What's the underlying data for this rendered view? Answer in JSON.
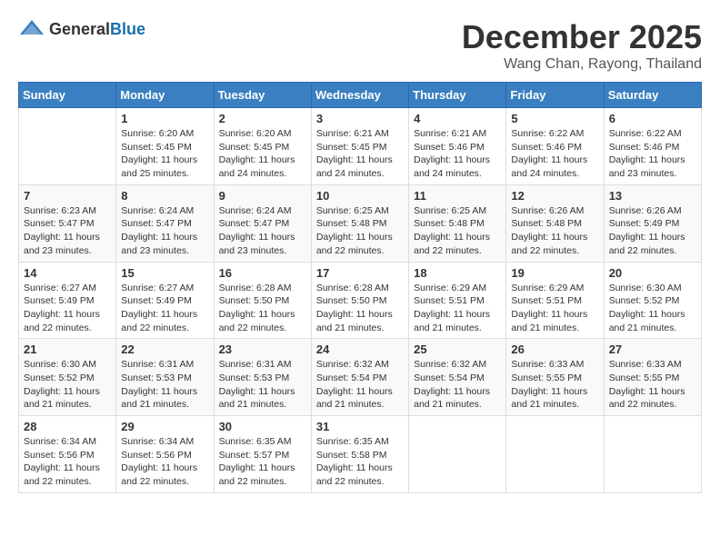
{
  "header": {
    "logo_general": "General",
    "logo_blue": "Blue",
    "month_title": "December 2025",
    "location": "Wang Chan, Rayong, Thailand"
  },
  "weekdays": [
    "Sunday",
    "Monday",
    "Tuesday",
    "Wednesday",
    "Thursday",
    "Friday",
    "Saturday"
  ],
  "weeks": [
    [
      {
        "day": "",
        "sunrise": "",
        "sunset": "",
        "daylight": ""
      },
      {
        "day": "1",
        "sunrise": "Sunrise: 6:20 AM",
        "sunset": "Sunset: 5:45 PM",
        "daylight": "Daylight: 11 hours and 25 minutes."
      },
      {
        "day": "2",
        "sunrise": "Sunrise: 6:20 AM",
        "sunset": "Sunset: 5:45 PM",
        "daylight": "Daylight: 11 hours and 24 minutes."
      },
      {
        "day": "3",
        "sunrise": "Sunrise: 6:21 AM",
        "sunset": "Sunset: 5:45 PM",
        "daylight": "Daylight: 11 hours and 24 minutes."
      },
      {
        "day": "4",
        "sunrise": "Sunrise: 6:21 AM",
        "sunset": "Sunset: 5:46 PM",
        "daylight": "Daylight: 11 hours and 24 minutes."
      },
      {
        "day": "5",
        "sunrise": "Sunrise: 6:22 AM",
        "sunset": "Sunset: 5:46 PM",
        "daylight": "Daylight: 11 hours and 24 minutes."
      },
      {
        "day": "6",
        "sunrise": "Sunrise: 6:22 AM",
        "sunset": "Sunset: 5:46 PM",
        "daylight": "Daylight: 11 hours and 23 minutes."
      }
    ],
    [
      {
        "day": "7",
        "sunrise": "Sunrise: 6:23 AM",
        "sunset": "Sunset: 5:47 PM",
        "daylight": "Daylight: 11 hours and 23 minutes."
      },
      {
        "day": "8",
        "sunrise": "Sunrise: 6:24 AM",
        "sunset": "Sunset: 5:47 PM",
        "daylight": "Daylight: 11 hours and 23 minutes."
      },
      {
        "day": "9",
        "sunrise": "Sunrise: 6:24 AM",
        "sunset": "Sunset: 5:47 PM",
        "daylight": "Daylight: 11 hours and 23 minutes."
      },
      {
        "day": "10",
        "sunrise": "Sunrise: 6:25 AM",
        "sunset": "Sunset: 5:48 PM",
        "daylight": "Daylight: 11 hours and 22 minutes."
      },
      {
        "day": "11",
        "sunrise": "Sunrise: 6:25 AM",
        "sunset": "Sunset: 5:48 PM",
        "daylight": "Daylight: 11 hours and 22 minutes."
      },
      {
        "day": "12",
        "sunrise": "Sunrise: 6:26 AM",
        "sunset": "Sunset: 5:48 PM",
        "daylight": "Daylight: 11 hours and 22 minutes."
      },
      {
        "day": "13",
        "sunrise": "Sunrise: 6:26 AM",
        "sunset": "Sunset: 5:49 PM",
        "daylight": "Daylight: 11 hours and 22 minutes."
      }
    ],
    [
      {
        "day": "14",
        "sunrise": "Sunrise: 6:27 AM",
        "sunset": "Sunset: 5:49 PM",
        "daylight": "Daylight: 11 hours and 22 minutes."
      },
      {
        "day": "15",
        "sunrise": "Sunrise: 6:27 AM",
        "sunset": "Sunset: 5:49 PM",
        "daylight": "Daylight: 11 hours and 22 minutes."
      },
      {
        "day": "16",
        "sunrise": "Sunrise: 6:28 AM",
        "sunset": "Sunset: 5:50 PM",
        "daylight": "Daylight: 11 hours and 22 minutes."
      },
      {
        "day": "17",
        "sunrise": "Sunrise: 6:28 AM",
        "sunset": "Sunset: 5:50 PM",
        "daylight": "Daylight: 11 hours and 21 minutes."
      },
      {
        "day": "18",
        "sunrise": "Sunrise: 6:29 AM",
        "sunset": "Sunset: 5:51 PM",
        "daylight": "Daylight: 11 hours and 21 minutes."
      },
      {
        "day": "19",
        "sunrise": "Sunrise: 6:29 AM",
        "sunset": "Sunset: 5:51 PM",
        "daylight": "Daylight: 11 hours and 21 minutes."
      },
      {
        "day": "20",
        "sunrise": "Sunrise: 6:30 AM",
        "sunset": "Sunset: 5:52 PM",
        "daylight": "Daylight: 11 hours and 21 minutes."
      }
    ],
    [
      {
        "day": "21",
        "sunrise": "Sunrise: 6:30 AM",
        "sunset": "Sunset: 5:52 PM",
        "daylight": "Daylight: 11 hours and 21 minutes."
      },
      {
        "day": "22",
        "sunrise": "Sunrise: 6:31 AM",
        "sunset": "Sunset: 5:53 PM",
        "daylight": "Daylight: 11 hours and 21 minutes."
      },
      {
        "day": "23",
        "sunrise": "Sunrise: 6:31 AM",
        "sunset": "Sunset: 5:53 PM",
        "daylight": "Daylight: 11 hours and 21 minutes."
      },
      {
        "day": "24",
        "sunrise": "Sunrise: 6:32 AM",
        "sunset": "Sunset: 5:54 PM",
        "daylight": "Daylight: 11 hours and 21 minutes."
      },
      {
        "day": "25",
        "sunrise": "Sunrise: 6:32 AM",
        "sunset": "Sunset: 5:54 PM",
        "daylight": "Daylight: 11 hours and 21 minutes."
      },
      {
        "day": "26",
        "sunrise": "Sunrise: 6:33 AM",
        "sunset": "Sunset: 5:55 PM",
        "daylight": "Daylight: 11 hours and 21 minutes."
      },
      {
        "day": "27",
        "sunrise": "Sunrise: 6:33 AM",
        "sunset": "Sunset: 5:55 PM",
        "daylight": "Daylight: 11 hours and 22 minutes."
      }
    ],
    [
      {
        "day": "28",
        "sunrise": "Sunrise: 6:34 AM",
        "sunset": "Sunset: 5:56 PM",
        "daylight": "Daylight: 11 hours and 22 minutes."
      },
      {
        "day": "29",
        "sunrise": "Sunrise: 6:34 AM",
        "sunset": "Sunset: 5:56 PM",
        "daylight": "Daylight: 11 hours and 22 minutes."
      },
      {
        "day": "30",
        "sunrise": "Sunrise: 6:35 AM",
        "sunset": "Sunset: 5:57 PM",
        "daylight": "Daylight: 11 hours and 22 minutes."
      },
      {
        "day": "31",
        "sunrise": "Sunrise: 6:35 AM",
        "sunset": "Sunset: 5:58 PM",
        "daylight": "Daylight: 11 hours and 22 minutes."
      },
      {
        "day": "",
        "sunrise": "",
        "sunset": "",
        "daylight": ""
      },
      {
        "day": "",
        "sunrise": "",
        "sunset": "",
        "daylight": ""
      },
      {
        "day": "",
        "sunrise": "",
        "sunset": "",
        "daylight": ""
      }
    ]
  ]
}
